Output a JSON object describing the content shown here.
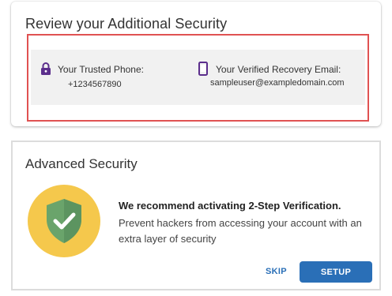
{
  "review": {
    "title": "Review your Additional Security",
    "phone_label": "Your Trusted Phone:",
    "phone_value": "+1234567890",
    "email_label": "Your Verified Recovery Email:",
    "email_value": "sampleuser@exampledomain.com"
  },
  "advanced": {
    "title": "Advanced Security",
    "recommendation_heading": "We recommend activating 2-Step Verification.",
    "recommendation_body": "Prevent hackers from accessing your account with an extra layer of security",
    "skip_label": "SKIP",
    "setup_label": "SETUP"
  },
  "icons": {
    "lock": "lock-icon",
    "phone": "phone-icon",
    "shield": "shield-check-icon"
  },
  "colors": {
    "accent_blue": "#2a6fb7",
    "highlight_red": "#e05252",
    "icon_purple": "#5b2e8c",
    "shield_green": "#6aa46b",
    "circle_yellow": "#f5c84c"
  }
}
